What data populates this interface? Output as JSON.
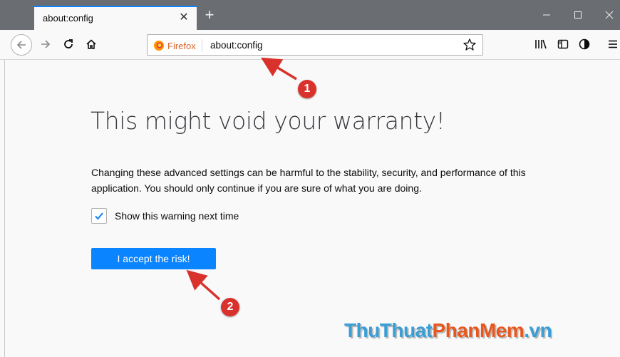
{
  "browser": {
    "tab_title": "about:config",
    "tab_close": "✕",
    "new_tab": "+",
    "window_controls": {
      "minimize": "—",
      "maximize": "☐",
      "close": "✕"
    }
  },
  "navbar": {
    "identity_label": "Firefox",
    "url": "about:config"
  },
  "warning_page": {
    "heading": "This might void your warranty!",
    "message": "Changing these advanced settings can be harmful to the stability, security, and performance of this application. You should only continue if you are sure of what you are doing.",
    "checkbox_label": "Show this warning next time",
    "checkbox_checked": true,
    "accept_button": "I accept the risk!"
  },
  "annotations": {
    "badge_1": "1",
    "badge_2": "2"
  },
  "watermark": {
    "part1": "ThuThuat",
    "part2": "PhanMem",
    "part3": ".vn"
  },
  "colors": {
    "accent": "#0a84ff",
    "annotation_red": "#d9312b",
    "titlebar": "#6a6d72"
  }
}
